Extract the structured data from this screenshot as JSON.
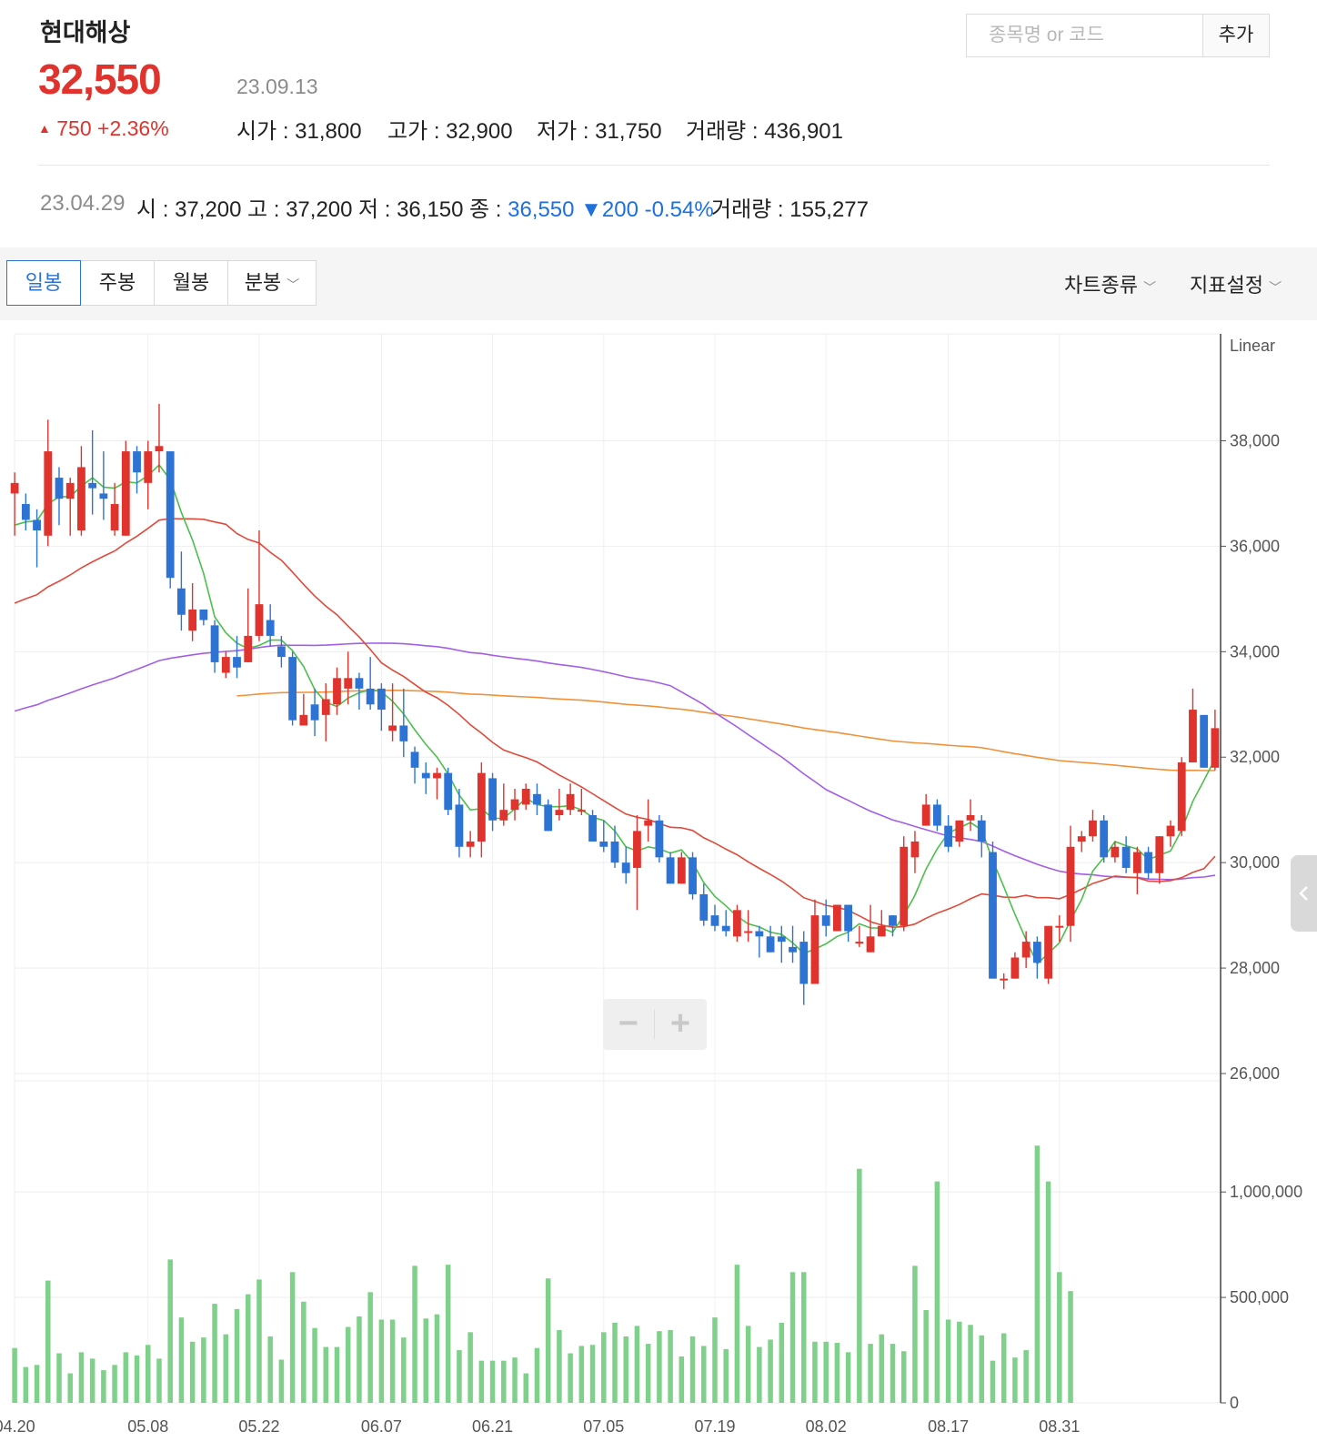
{
  "stock": {
    "name": "현대해상",
    "price": "32,550",
    "date": "23.09.13",
    "change": "750 +2.36%",
    "open": "시가 : 31,800",
    "high": "고가 : 32,900",
    "low": "저가 : 31,750",
    "volume": "거래량 : 436,901"
  },
  "search": {
    "placeholder": "종목명 or 코드",
    "add_label": "추가"
  },
  "history": {
    "date": "23.04.29",
    "open": "시 : 37,200",
    "high": "고 : 37,200",
    "low": "저 : 36,150",
    "close_label": "종 :",
    "close_value": "36,550",
    "change": "▼200 -0.54%",
    "volume": "거래량 : 155,277"
  },
  "toolbar": {
    "tabs": [
      "일봉",
      "주봉",
      "월봉",
      "분봉"
    ],
    "chart_type": "차트종류",
    "indicator_settings": "지표설정"
  },
  "icons": {
    "up": "triangle-up-icon",
    "chevron": "chevron-down-icon",
    "collapse": "chevron-left-icon",
    "zoom_out": "minus-icon",
    "zoom_in": "plus-icon"
  },
  "colors": {
    "up": "#e0332d",
    "down": "#2d73d4",
    "volume": "#7fd08a",
    "ma5": "#4cbf4c",
    "ma20": "#e04a3a",
    "ma60": "#a35ee8",
    "ma120": "#f0923a"
  },
  "chart_data": {
    "type": "candlestick",
    "scale_label": "Linear",
    "x_tick_labels": [
      "04.20",
      "05.08",
      "05.22",
      "06.07",
      "06.21",
      "07.05",
      "07.19",
      "08.02",
      "08.17",
      "08.31"
    ],
    "y_ticks": [
      "38,000",
      "36,000",
      "34,000",
      "32,000",
      "30,000",
      "28,000",
      "26,000"
    ],
    "ylim": [
      26000,
      39000
    ],
    "volume_ticks": [
      "1,000,000",
      "500,000",
      "0"
    ],
    "volume_ylim": [
      0,
      1400000
    ],
    "candles": [
      [
        37000,
        37200,
        36200,
        37400
      ],
      [
        36800,
        36500,
        36300,
        37000
      ],
      [
        36500,
        36300,
        35600,
        36700
      ],
      [
        36200,
        37800,
        36000,
        38400
      ],
      [
        37300,
        36900,
        36400,
        37500
      ],
      [
        36900,
        37200,
        36200,
        37300
      ],
      [
        36300,
        37500,
        36200,
        37900
      ],
      [
        37200,
        37100,
        36600,
        38200
      ],
      [
        37000,
        36900,
        36500,
        37800
      ],
      [
        36300,
        36800,
        36200,
        37200
      ],
      [
        36200,
        37800,
        36200,
        38000
      ],
      [
        37800,
        37400,
        37000,
        37900
      ],
      [
        37200,
        37800,
        36700,
        38000
      ],
      [
        37800,
        37900,
        37400,
        38700
      ],
      [
        37800,
        35400,
        35200,
        37800
      ],
      [
        35200,
        34700,
        34400,
        35900
      ],
      [
        34400,
        34800,
        34200,
        35300
      ],
      [
        34800,
        34600,
        34500,
        34800
      ],
      [
        34500,
        33800,
        33600,
        34600
      ],
      [
        33600,
        33900,
        33500,
        34000
      ],
      [
        33900,
        33700,
        33500,
        34300
      ],
      [
        33800,
        34300,
        33800,
        35200
      ],
      [
        34300,
        34900,
        34200,
        36300
      ],
      [
        34600,
        34300,
        34100,
        34900
      ],
      [
        34100,
        33900,
        33700,
        34300
      ],
      [
        33900,
        32700,
        32600,
        34000
      ],
      [
        32600,
        32800,
        32600,
        33200
      ],
      [
        33000,
        32700,
        32400,
        33300
      ],
      [
        32800,
        33100,
        32300,
        33400
      ],
      [
        33000,
        33500,
        32800,
        33700
      ],
      [
        33300,
        33500,
        33000,
        34000
      ],
      [
        33500,
        33300,
        32900,
        33600
      ],
      [
        33300,
        33000,
        32900,
        33900
      ],
      [
        33300,
        32900,
        32500,
        33400
      ],
      [
        32500,
        32600,
        32300,
        33400
      ],
      [
        32600,
        32300,
        32000,
        33300
      ],
      [
        32100,
        31800,
        31500,
        32200
      ],
      [
        31700,
        31600,
        31300,
        31900
      ],
      [
        31600,
        31700,
        31200,
        31800
      ],
      [
        31700,
        31000,
        30900,
        31800
      ],
      [
        31100,
        30300,
        30100,
        31400
      ],
      [
        30300,
        30400,
        30100,
        30600
      ],
      [
        30400,
        31700,
        30100,
        31900
      ],
      [
        31600,
        30800,
        30600,
        31700
      ],
      [
        30800,
        31000,
        30700,
        31500
      ],
      [
        31000,
        31200,
        30800,
        31400
      ],
      [
        31100,
        31400,
        31000,
        31500
      ],
      [
        31300,
        31100,
        30900,
        31500
      ],
      [
        31100,
        30600,
        30600,
        31200
      ],
      [
        30900,
        31000,
        30800,
        31400
      ],
      [
        31000,
        31300,
        30900,
        31500
      ],
      [
        31000,
        31000,
        30900,
        31400
      ],
      [
        30900,
        30400,
        30400,
        31000
      ],
      [
        30400,
        30300,
        30200,
        30800
      ],
      [
        30400,
        30000,
        29900,
        30700
      ],
      [
        30000,
        29800,
        29600,
        30300
      ],
      [
        29900,
        30600,
        29100,
        30900
      ],
      [
        30700,
        30800,
        30400,
        31200
      ],
      [
        30800,
        30100,
        30000,
        30900
      ],
      [
        30100,
        29600,
        29600,
        30200
      ],
      [
        29600,
        30100,
        29600,
        30200
      ],
      [
        30100,
        29400,
        29300,
        30200
      ],
      [
        29400,
        28900,
        28800,
        29600
      ],
      [
        29000,
        28800,
        28700,
        29200
      ],
      [
        28800,
        28700,
        28600,
        29100
      ],
      [
        28600,
        29100,
        28500,
        29200
      ],
      [
        28700,
        28700,
        28500,
        29100
      ],
      [
        28700,
        28600,
        28200,
        28800
      ],
      [
        28600,
        28300,
        28300,
        28800
      ],
      [
        28600,
        28500,
        28100,
        28800
      ],
      [
        28400,
        28300,
        28100,
        28800
      ],
      [
        28500,
        27700,
        27300,
        28700
      ],
      [
        27700,
        29000,
        27700,
        29300
      ],
      [
        29000,
        28800,
        28600,
        29300
      ],
      [
        28700,
        29200,
        28700,
        29200
      ],
      [
        29200,
        28700,
        28500,
        28700
      ],
      [
        28500,
        28500,
        28400,
        28800
      ],
      [
        28300,
        28600,
        28300,
        29200
      ],
      [
        28600,
        28800,
        28600,
        29100
      ],
      [
        29000,
        28800,
        28600,
        29000
      ],
      [
        28800,
        30300,
        28700,
        30500
      ],
      [
        30100,
        30400,
        29800,
        30600
      ],
      [
        30700,
        31100,
        30700,
        31300
      ],
      [
        31100,
        30700,
        30600,
        31200
      ],
      [
        30700,
        30300,
        30200,
        30900
      ],
      [
        30400,
        30800,
        30300,
        30800
      ],
      [
        30800,
        30900,
        30600,
        31200
      ],
      [
        30800,
        30400,
        30100,
        30900
      ],
      [
        30200,
        27800,
        27800,
        30400
      ],
      [
        27800,
        27800,
        27600,
        27900
      ],
      [
        27800,
        28200,
        27800,
        28300
      ],
      [
        28200,
        28500,
        28000,
        28700
      ],
      [
        28500,
        28100,
        27800,
        28600
      ],
      [
        27800,
        28800,
        27700,
        28800
      ],
      [
        28800,
        28800,
        28500,
        29000
      ],
      [
        28800,
        30300,
        28500,
        30700
      ],
      [
        30400,
        30500,
        30200,
        30600
      ],
      [
        30500,
        30800,
        30400,
        31000
      ],
      [
        30800,
        30100,
        30000,
        30900
      ],
      [
        30100,
        30300,
        30000,
        30400
      ],
      [
        30300,
        29900,
        29800,
        30500
      ],
      [
        29800,
        30200,
        29400,
        30300
      ],
      [
        30200,
        29800,
        29700,
        30300
      ],
      [
        29800,
        30500,
        29600,
        30500
      ],
      [
        30500,
        30700,
        30300,
        30800
      ],
      [
        30600,
        31900,
        30500,
        32000
      ],
      [
        31900,
        32900,
        31900,
        33300
      ],
      [
        32800,
        31800,
        31800,
        32800
      ],
      [
        31800,
        32550,
        31750,
        32900
      ]
    ],
    "volumes": [
      260000,
      170000,
      180000,
      580000,
      235000,
      140000,
      240000,
      210000,
      155000,
      180000,
      240000,
      225000,
      275000,
      210000,
      680000,
      405000,
      290000,
      310000,
      470000,
      325000,
      445000,
      515000,
      585000,
      315000,
      205000,
      620000,
      480000,
      355000,
      265000,
      265000,
      360000,
      410000,
      525000,
      395000,
      395000,
      310000,
      650000,
      400000,
      420000,
      655000,
      250000,
      335000,
      200000,
      200000,
      200000,
      215000,
      140000,
      260000,
      590000,
      345000,
      235000,
      270000,
      275000,
      335000,
      380000,
      315000,
      365000,
      280000,
      340000,
      345000,
      220000,
      315000,
      270000,
      405000,
      255000,
      655000,
      365000,
      265000,
      300000,
      380000,
      620000,
      620000,
      290000,
      290000,
      285000,
      240000,
      1110000,
      280000,
      325000,
      280000,
      245000,
      650000,
      440000,
      1050000,
      395000,
      385000,
      370000,
      320000,
      200000,
      330000,
      215000,
      250000,
      1220000,
      1050000,
      620000,
      530000
    ]
  }
}
